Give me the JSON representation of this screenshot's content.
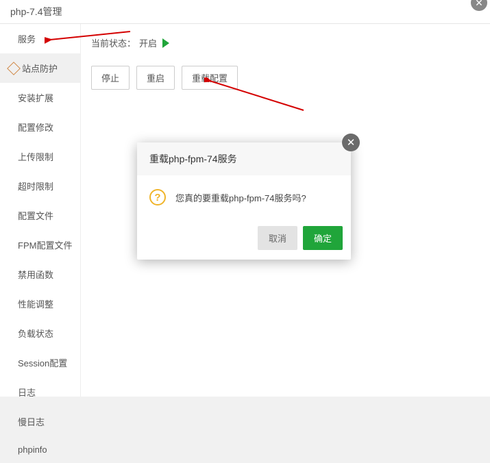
{
  "title": "php-7.4管理",
  "status": {
    "label": "当前状态：",
    "value": "开启"
  },
  "buttons": {
    "stop": "停止",
    "restart": "重启",
    "reload": "重载配置"
  },
  "sidebar": {
    "items": [
      "服务",
      "站点防护",
      "安装扩展",
      "配置修改",
      "上传限制",
      "超时限制",
      "配置文件",
      "FPM配置文件",
      "禁用函数",
      "性能调整",
      "负载状态",
      "Session配置",
      "日志",
      "慢日志",
      "phpinfo"
    ]
  },
  "modal": {
    "title": "重载php-fpm-74服务",
    "message": "您真的要重载php-fpm-74服务吗?",
    "cancel": "取消",
    "ok": "确定"
  }
}
